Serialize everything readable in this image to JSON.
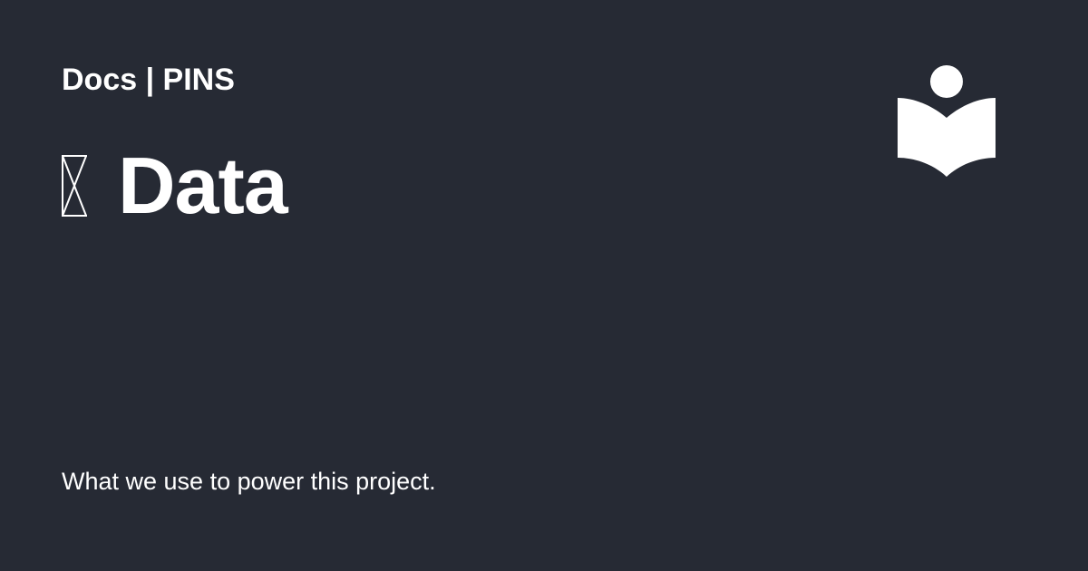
{
  "theme": {
    "background": "#262a34",
    "text": "#ffffff"
  },
  "header": {
    "site_title": "Docs | PINS"
  },
  "heading": {
    "glyph_icon": "missing-glyph-icon",
    "title": "Data"
  },
  "description": "What we use to power this project.",
  "logo": {
    "icon": "reader-book-icon"
  }
}
